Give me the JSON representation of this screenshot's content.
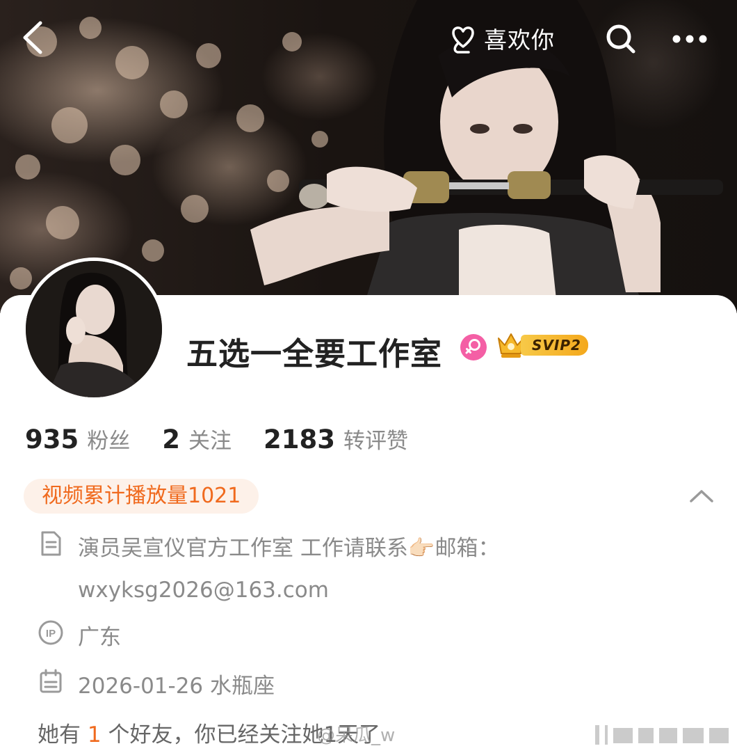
{
  "topbar": {
    "like_label": "喜欢你"
  },
  "profile": {
    "name": "五选一全要工作室",
    "vip_label": "SVIP2"
  },
  "stats": [
    {
      "value": "935",
      "label": "粉丝"
    },
    {
      "value": "2",
      "label": "关注"
    },
    {
      "value": "2183",
      "label": "转评赞"
    }
  ],
  "video_pill": "视频累计播放量1021",
  "info": {
    "description": "演员吴宣仪官方工作室 工作请联系👉🏻邮箱：wxyksg2026@163.com",
    "ip_location": "广东",
    "birthday": "2026-01-26 水瓶座"
  },
  "friends": {
    "prefix": "她有",
    "count": "1",
    "suffix": "个好友，你已经关注她1天了"
  },
  "watermark": "@呆瓜_w",
  "colors": {
    "accent_orange": "#f06a1e",
    "pill_bg": "#fdf1e9",
    "gender_pink": "#f45fa5",
    "vip_gold": "#f4a81c"
  }
}
